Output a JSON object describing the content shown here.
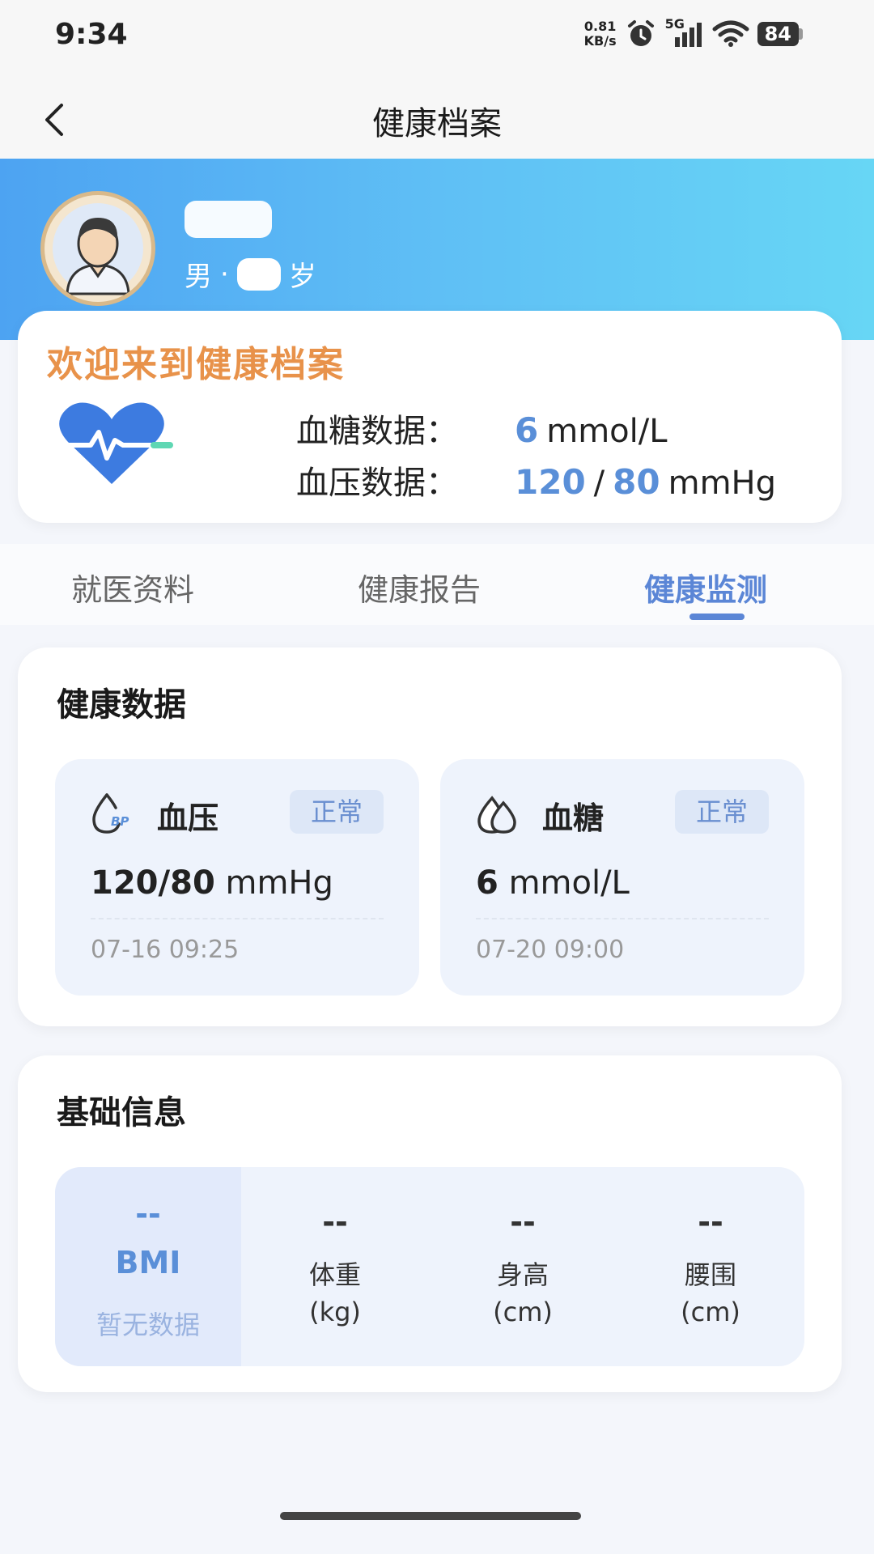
{
  "status_bar": {
    "time": "9:34",
    "net_speed_value": "0.81",
    "net_speed_unit": "KB/s",
    "network": "5G",
    "battery": "84"
  },
  "nav": {
    "title": "健康档案"
  },
  "profile": {
    "gender": "男",
    "separator": "·",
    "age_suffix": "岁"
  },
  "welcome": {
    "title": "欢迎来到健康档案",
    "glucose_label": "血糖数据：",
    "glucose_value": "6",
    "glucose_unit": "mmol/L",
    "bp_label": "血压数据：",
    "bp_systolic": "120",
    "bp_sep": "/",
    "bp_diastolic": "80",
    "bp_unit": "mmHg"
  },
  "tabs": [
    {
      "label": "就医资料",
      "active": false
    },
    {
      "label": "健康报告",
      "active": false
    },
    {
      "label": "健康监测",
      "active": true
    }
  ],
  "health_data": {
    "title": "健康数据",
    "items": [
      {
        "title": "血压",
        "status": "正常",
        "value": "120/80",
        "unit": "mmHg",
        "time": "07-16 09:25",
        "icon": "blood-pressure-icon",
        "icon_text": "BP"
      },
      {
        "title": "血糖",
        "status": "正常",
        "value": "6",
        "unit": "mmol/L",
        "time": "07-20 09:00",
        "icon": "blood-glucose-icon"
      }
    ]
  },
  "basic_info": {
    "title": "基础信息",
    "bmi": {
      "value": "--",
      "label": "BMI",
      "note": "暂无数据"
    },
    "cells": [
      {
        "value": "--",
        "label": "体重",
        "unit": "(kg)"
      },
      {
        "value": "--",
        "label": "身高",
        "unit": "(cm)"
      },
      {
        "value": "--",
        "label": "腰围",
        "unit": "(cm)"
      }
    ]
  },
  "colors": {
    "accent": "#5b86d6",
    "welcome_title": "#e8924a",
    "header_start": "#4da3f2",
    "header_end": "#67d6f5"
  }
}
